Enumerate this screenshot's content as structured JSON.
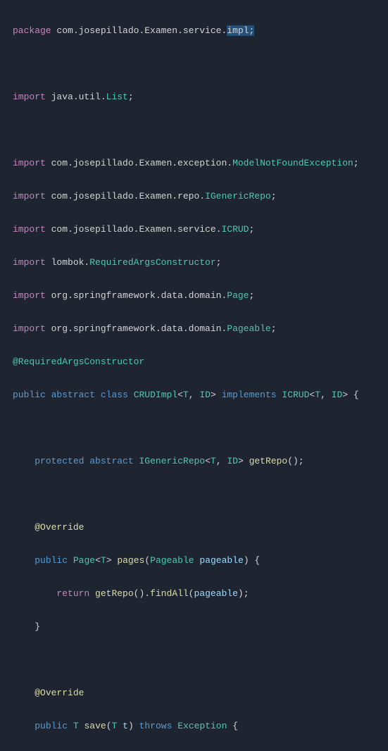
{
  "code": {
    "line1": {
      "kw": "package",
      "path": "com.josepillado.Examen.service.",
      "sel": "impl;"
    },
    "line2": {
      "kw": "import",
      "path": "java.util.",
      "type": "List",
      "end": ";"
    },
    "line3": {
      "kw": "import",
      "path": "com.josepillado.Examen.exception.",
      "type": "ModelNotFoundException",
      "end": ";"
    },
    "line4": {
      "kw": "import",
      "path": "com.josepillado.Examen.repo.",
      "type": "IGenericRepo",
      "end": ";"
    },
    "line5": {
      "kw": "import",
      "path": "com.josepillado.Examen.service.",
      "type": "ICRUD",
      "end": ";"
    },
    "line6": {
      "kw": "import",
      "path": "lombok.",
      "type": "RequiredArgsConstructor",
      "end": ";"
    },
    "line7": {
      "kw": "import",
      "path": "org.springframework.data.domain.",
      "type": "Page",
      "end": ";"
    },
    "line8": {
      "kw": "import",
      "path": "org.springframework.data.domain.",
      "type": "Pageable",
      "end": ";"
    },
    "line9": {
      "ann": "@RequiredArgsConstructor"
    },
    "line10": {
      "pub": "public",
      "abs": "abstract",
      "cls": "class",
      "name": "CRUDImpl",
      "lt": "<",
      "t": "T",
      "c1": ", ",
      "id": "ID",
      "gt": ">",
      "impl": "implements",
      "iface": "ICRUD",
      "lt2": "<",
      "t2": "T",
      "c2": ", ",
      "id2": "ID",
      "gt2": ">",
      "brace": " {"
    },
    "line11": {
      "prot": "protected",
      "abs": "abstract",
      "type": "IGenericRepo",
      "lt": "<",
      "t": "T",
      "c1": ", ",
      "id": "ID",
      "gt": ">",
      "method": "getRepo",
      "parens": "();"
    },
    "line12": {
      "ann": "@Override"
    },
    "line13": {
      "pub": "public",
      "type": "Page",
      "lt": "<",
      "t": "T",
      "gt": ">",
      "method": "pages",
      "lp": "(",
      "ptype": "Pageable",
      "pname": "pageable",
      "rp": ") {"
    },
    "line14": {
      "ret": "return",
      "m1": "getRepo",
      "p1": "().",
      "m2": "findAll",
      "lp": "(",
      "arg": "pageable",
      "rp": ");"
    },
    "line15": {
      "brace": "}"
    },
    "line16": {
      "ann": "@Override"
    },
    "line17": {
      "pub": "public",
      "type": "T",
      "method": "save",
      "lp": "(",
      "ptype": "T",
      "pname": "t",
      "rp": ")",
      "thr": "throws",
      "exc": "Exception",
      "brace": " {"
    }
  }
}
